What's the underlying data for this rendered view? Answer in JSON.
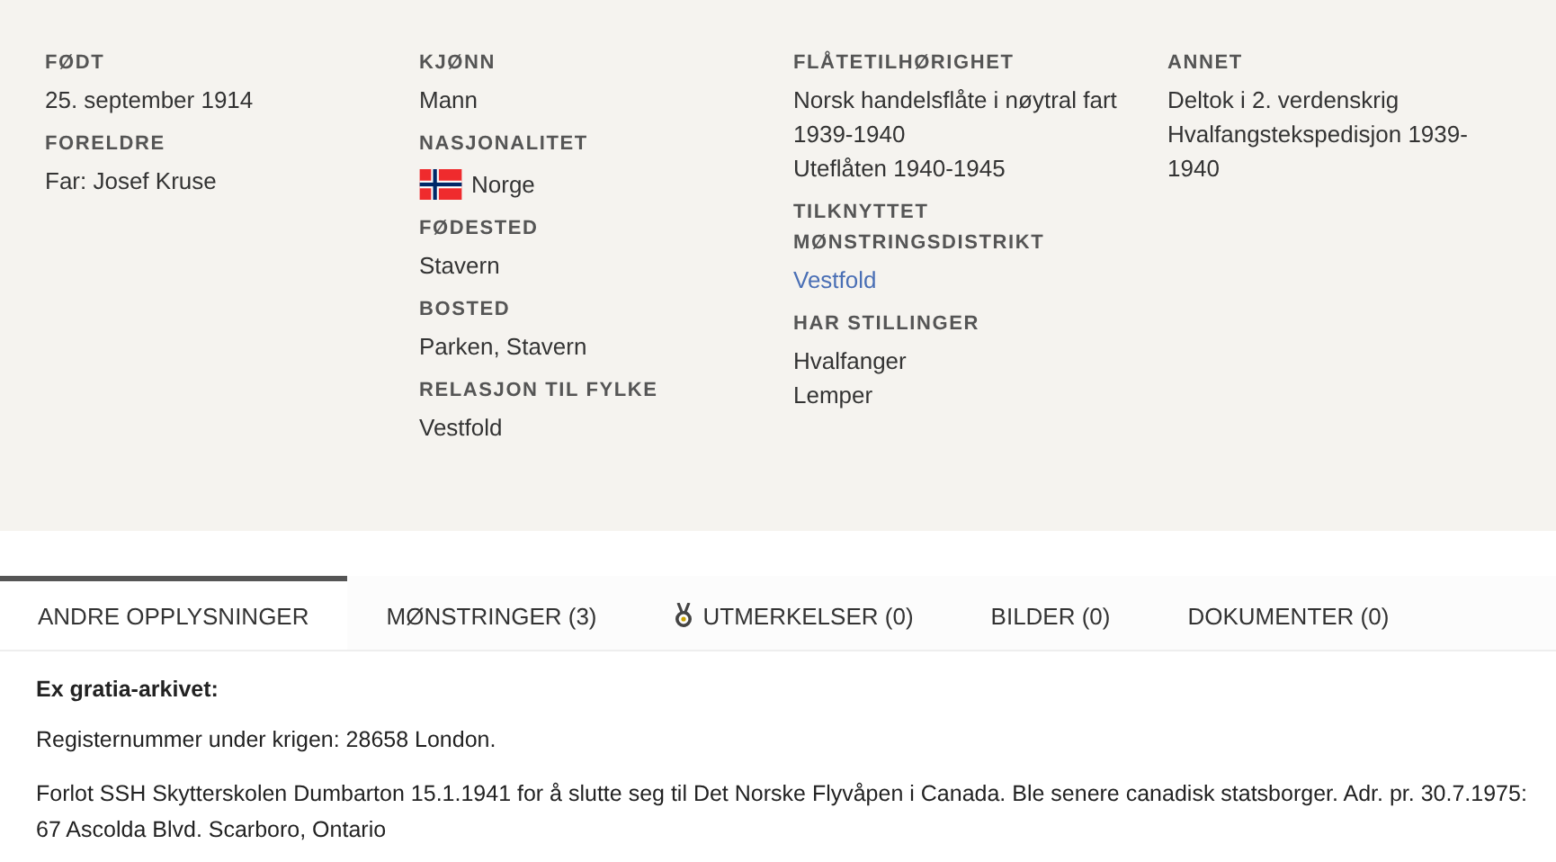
{
  "facts": {
    "columns": [
      {
        "fields": [
          {
            "label": "FØDT",
            "values": [
              {
                "kind": "text",
                "text": "25. september 1914"
              }
            ]
          },
          {
            "label": "FORELDRE",
            "values": [
              {
                "kind": "text",
                "text": "Far: Josef Kruse"
              }
            ]
          }
        ]
      },
      {
        "fields": [
          {
            "label": "KJØNN",
            "values": [
              {
                "kind": "text",
                "text": "Mann"
              }
            ]
          },
          {
            "label": "NASJONALITET",
            "values": [
              {
                "kind": "flag",
                "text": "Norge"
              }
            ]
          },
          {
            "label": "FØDESTED",
            "values": [
              {
                "kind": "text",
                "text": "Stavern"
              }
            ]
          },
          {
            "label": "BOSTED",
            "values": [
              {
                "kind": "text",
                "text": "Parken, Stavern"
              }
            ]
          },
          {
            "label": "RELASJON TIL FYLKE",
            "values": [
              {
                "kind": "text",
                "text": "Vestfold"
              }
            ]
          }
        ]
      },
      {
        "fields": [
          {
            "label": "FLÅTETILHØRIGHET",
            "values": [
              {
                "kind": "text",
                "text": "Norsk handelsflåte i nøytral fart 1939-1940"
              },
              {
                "kind": "text",
                "text": "Uteflåten 1940-1945"
              }
            ]
          },
          {
            "label": "TILKNYTTET MØNSTRINGSDISTRIKT",
            "values": [
              {
                "kind": "link",
                "text": "Vestfold"
              }
            ]
          },
          {
            "label": "HAR STILLINGER",
            "values": [
              {
                "kind": "text",
                "text": "Hvalfanger"
              },
              {
                "kind": "text",
                "text": "Lemper"
              }
            ]
          }
        ]
      },
      {
        "fields": [
          {
            "label": "ANNET",
            "values": [
              {
                "kind": "text",
                "text": "Deltok i 2. verdenskrig"
              },
              {
                "kind": "text",
                "text": "Hvalfangstekspedisjon 1939-1940"
              }
            ]
          }
        ]
      }
    ]
  },
  "tabs": [
    {
      "label": "ANDRE OPPLYSNINGER",
      "selected": true,
      "kind": "plain"
    },
    {
      "label": "MØNSTRINGER (3)",
      "selected": false,
      "kind": "plain"
    },
    {
      "label": "UTMERKELSER (0)",
      "selected": false,
      "kind": "medal"
    },
    {
      "label": "BILDER (0)",
      "selected": false,
      "kind": "plain"
    },
    {
      "label": "DOKUMENTER (0)",
      "selected": false,
      "kind": "plain"
    }
  ],
  "content": {
    "heading": "Ex gratia-arkivet:",
    "paragraphs": [
      "Registernummer under krigen: 28658 London.",
      "Forlot SSH Skytterskolen Dumbarton 15.1.1941 for å slutte seg til Det Norske Flyvåpen i Canada. Ble senere canadisk statsborger. Adr. pr. 30.7.1975: 67 Ascolda Blvd. Scarboro, Ontario"
    ]
  }
}
